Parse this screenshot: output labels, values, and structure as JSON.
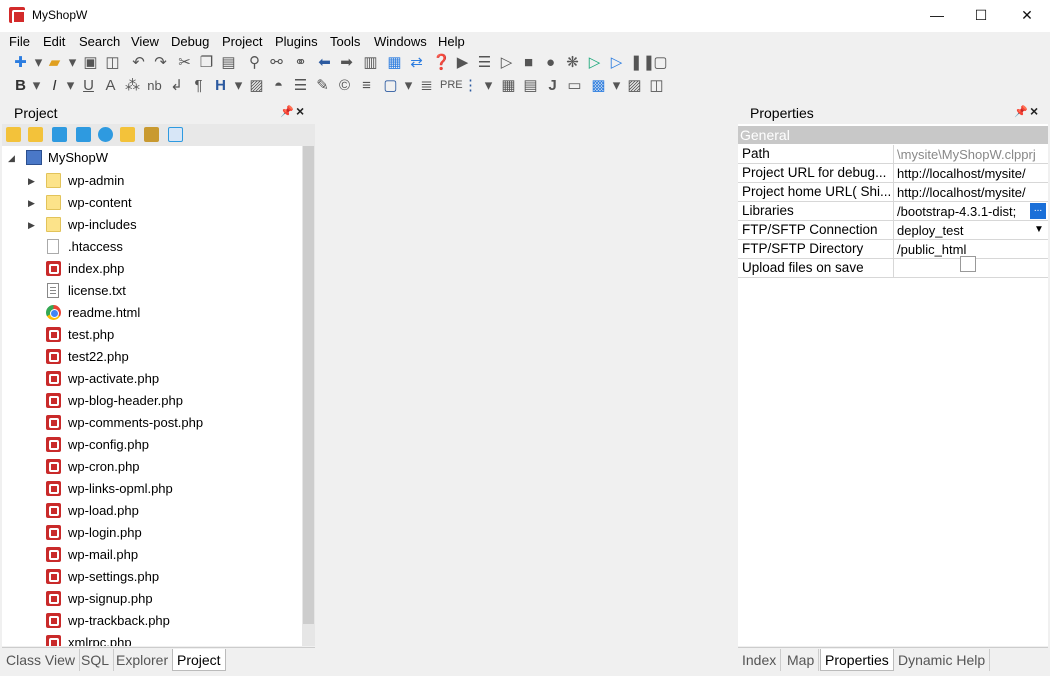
{
  "window": {
    "title": "MyShopW",
    "minimize": "—",
    "maximize": "☐",
    "close": "✕"
  },
  "menu": [
    "File",
    "Edit",
    "Search",
    "View",
    "Debug",
    "Project",
    "Plugins",
    "Tools",
    "Windows",
    "Help"
  ],
  "project_panel": {
    "title": "Project",
    "root": "MyShopW",
    "folders": [
      "wp-admin",
      "wp-content",
      "wp-includes"
    ],
    "files": [
      {
        "name": ".htaccess",
        "icon": "htaccess-file-icon"
      },
      {
        "name": "index.php",
        "icon": "php-file-icon"
      },
      {
        "name": "license.txt",
        "icon": "text-file-icon"
      },
      {
        "name": "readme.html",
        "icon": "chrome-html-icon"
      },
      {
        "name": "test.php",
        "icon": "php-file-icon"
      },
      {
        "name": "test22.php",
        "icon": "php-file-icon"
      },
      {
        "name": "wp-activate.php",
        "icon": "php-file-icon"
      },
      {
        "name": "wp-blog-header.php",
        "icon": "php-file-icon"
      },
      {
        "name": "wp-comments-post.php",
        "icon": "php-file-icon"
      },
      {
        "name": "wp-config.php",
        "icon": "php-file-icon"
      },
      {
        "name": "wp-cron.php",
        "icon": "php-file-icon"
      },
      {
        "name": "wp-links-opml.php",
        "icon": "php-file-icon"
      },
      {
        "name": "wp-load.php",
        "icon": "php-file-icon"
      },
      {
        "name": "wp-login.php",
        "icon": "php-file-icon"
      },
      {
        "name": "wp-mail.php",
        "icon": "php-file-icon"
      },
      {
        "name": "wp-settings.php",
        "icon": "php-file-icon"
      },
      {
        "name": "wp-signup.php",
        "icon": "php-file-icon"
      },
      {
        "name": "wp-trackback.php",
        "icon": "php-file-icon"
      },
      {
        "name": "xmlrpc.php",
        "icon": "php-file-icon"
      }
    ]
  },
  "left_tabs": [
    "Class View",
    "SQL",
    "Explorer",
    "Project"
  ],
  "left_active_tab": "Project",
  "properties_panel": {
    "title": "Properties",
    "group": "General",
    "rows": [
      {
        "name": "Path",
        "value": "\\mysite\\MyShopW.clpprj",
        "style": "gray"
      },
      {
        "name": "Project URL for debug...",
        "value": "http://localhost/mysite/"
      },
      {
        "name": "Project home URL( Shi...",
        "value": "http://localhost/mysite/"
      },
      {
        "name": "Libraries",
        "value": "/bootstrap-4.3.1-dist;",
        "button": "..."
      },
      {
        "name": "FTP/SFTP Connection",
        "value": "deploy_test",
        "dropdown": "▼"
      },
      {
        "name": "FTP/SFTP Directory",
        "value": "/public_html"
      },
      {
        "name": "Upload files on save",
        "value": "",
        "checkbox": false
      }
    ]
  },
  "right_tabs": [
    "Index",
    "Map",
    "Properties",
    "Dynamic Help"
  ],
  "right_active_tab": "Properties"
}
